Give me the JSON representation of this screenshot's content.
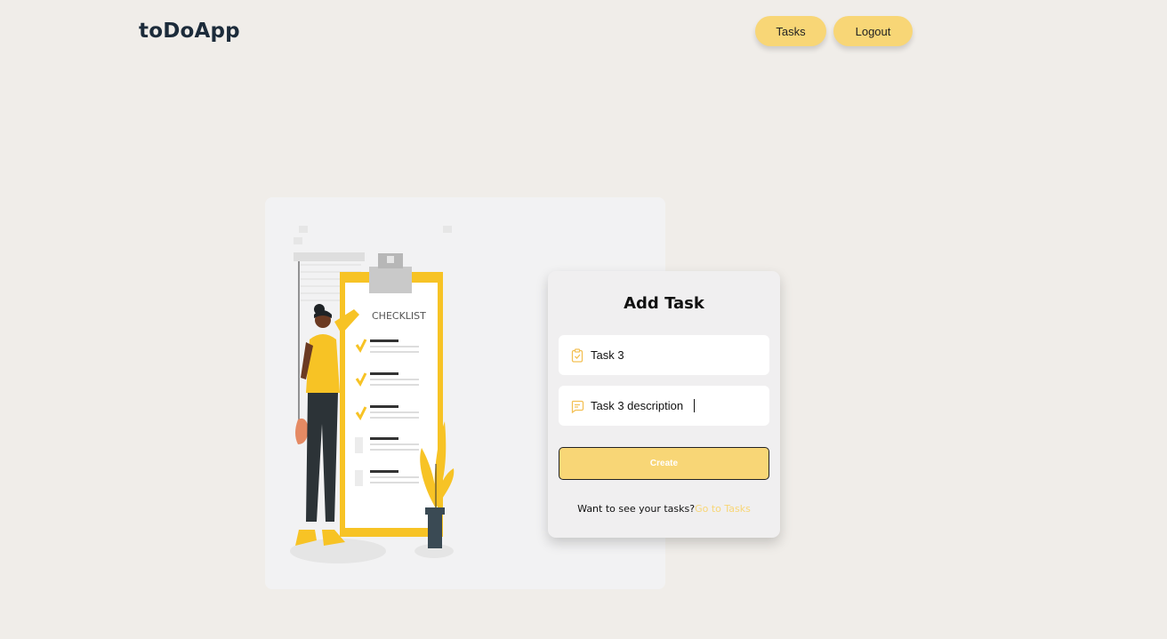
{
  "header": {
    "brand": "toDoApp",
    "nav": {
      "tasks_label": "Tasks",
      "logout_label": "Logout"
    }
  },
  "illustration": {
    "checklist_label": "CHECKLIST"
  },
  "form": {
    "title": "Add Task",
    "title_field": {
      "value": "Task 3",
      "icon": "clipboard-check-icon"
    },
    "description_field": {
      "value": "Task 3 description",
      "icon": "message-square-icon"
    },
    "create_label": "Create",
    "footer_prompt": "Want to see your tasks?",
    "footer_link": "Go to Tasks"
  },
  "colors": {
    "background": "#f0ede9",
    "accent": "#f8d676",
    "brand_text": "#1c2b3a"
  }
}
